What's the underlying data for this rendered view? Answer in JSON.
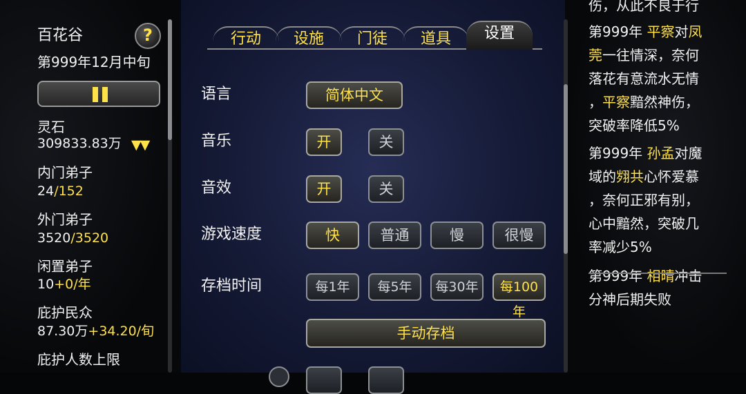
{
  "sidebar": {
    "sect_name": "百花谷",
    "date": "第999年12月中旬",
    "help_glyph": "?",
    "stones_label": "灵石",
    "stones_value": "309833.83万",
    "stones_trend": "▼▼",
    "inner_label": "内门弟子",
    "inner_current": "24",
    "inner_max": "/152",
    "outer_label": "外门弟子",
    "outer_current": "3520",
    "outer_max": "/3520",
    "idle_label": "闲置弟子",
    "idle_value": "10",
    "idle_rate": "+0/年",
    "people_label": "庇护民众",
    "people_value": "87.30万",
    "people_rate": "+34.20/旬",
    "people_cap_label": "庇护人数上限"
  },
  "tabs": [
    "行动",
    "设施",
    "门徒",
    "道具",
    "设置"
  ],
  "settings": {
    "language_label": "语言",
    "language_value": "简体中文",
    "music_label": "音乐",
    "sfx_label": "音效",
    "on": "开",
    "off": "关",
    "speed_label": "游戏速度",
    "speeds": [
      "快",
      "普通",
      "慢",
      "很慢"
    ],
    "save_label": "存档时间",
    "saves": [
      "每1年",
      "每5年",
      "每30年",
      "每100年"
    ],
    "manual_save": "手动存档"
  },
  "log": {
    "l0": "伤，从此不良于行",
    "e1_year": "第999年 ",
    "e1_name": "平察",
    "e1_t1": "对",
    "e1_name2a": "凤",
    "e1_name2b": "莞",
    "e1_t2": "一往情深，奈何",
    "e1_t3": "落花有意流水无情",
    "e1_t4a": "，",
    "e1_name3": "平察",
    "e1_t4b": "黯然神伤，",
    "e1_t5": "突破率降低5%",
    "e2_year": "第999年 ",
    "e2_name": "孙孟",
    "e2_t1": "对魔",
    "e2_t2a": "域的",
    "e2_name2": "翙共",
    "e2_t2b": "心怀爱慕",
    "e2_t3": "，奈何正邪有别，",
    "e2_t4": "心中黯然，突破几",
    "e2_t5": "率减少5%",
    "e3_year": "第999年 ",
    "e3_name": "相晴",
    "e3_t1": "冲击",
    "e3_t2": "分神后期失败"
  }
}
